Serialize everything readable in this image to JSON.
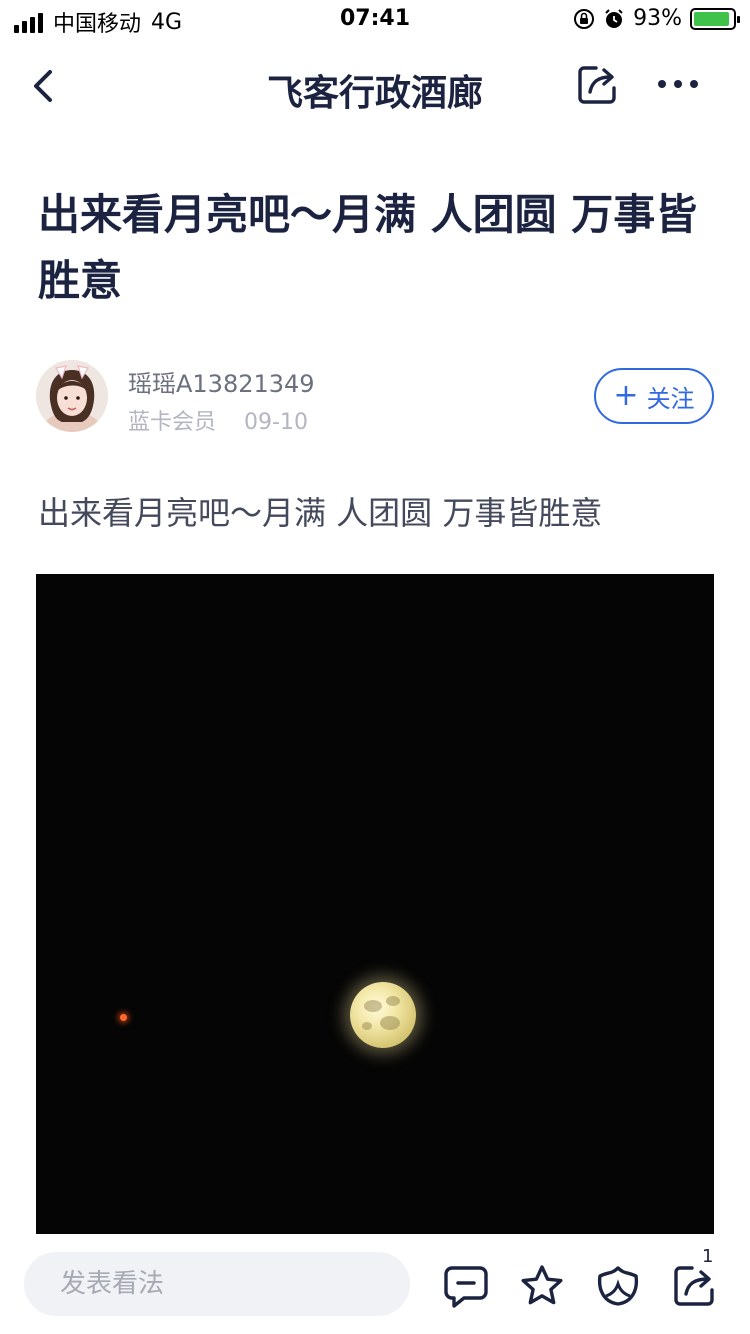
{
  "status_bar": {
    "carrier": "中国移动",
    "network": "4G",
    "time": "07:41",
    "battery": "93%",
    "battery_level": 0.93,
    "icons": [
      "signal-icon",
      "orientation-lock-icon",
      "alarm-icon",
      "battery-charging-icon"
    ]
  },
  "nav": {
    "title": "飞客行政酒廊",
    "icons": [
      "back-icon",
      "share-icon",
      "more-icon"
    ]
  },
  "article": {
    "title": "出来看月亮吧～月满 人团圆 万事皆胜意",
    "author": {
      "name": "瑶瑶A13821349",
      "level": "蓝卡会员",
      "date": "09-10"
    },
    "follow_label": "关注",
    "follow_plus": "+",
    "body": "出来看月亮吧～月满 人团圆 万事皆胜意"
  },
  "bottom_bar": {
    "comment_placeholder": "发表看法",
    "share_count": "1",
    "icons": [
      "comment-icon",
      "star-icon",
      "like-icon",
      "share-icon"
    ]
  },
  "colors": {
    "accent": "#3069e0",
    "title": "#1c2340",
    "battery": "#3fc24a"
  }
}
